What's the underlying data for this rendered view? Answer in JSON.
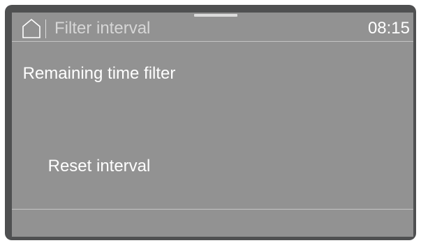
{
  "header": {
    "home_icon": "home-icon",
    "title": "Filter interval",
    "time": "08:15"
  },
  "menu": {
    "items": [
      {
        "label": "Remaining time filter"
      },
      {
        "label": "Reset interval"
      }
    ]
  },
  "colors": {
    "screen_background": "#929292",
    "bezel": "#4f5051",
    "text": "#ffffff",
    "header_title": "#d6d6d6",
    "divider": "#c4c4c4"
  }
}
